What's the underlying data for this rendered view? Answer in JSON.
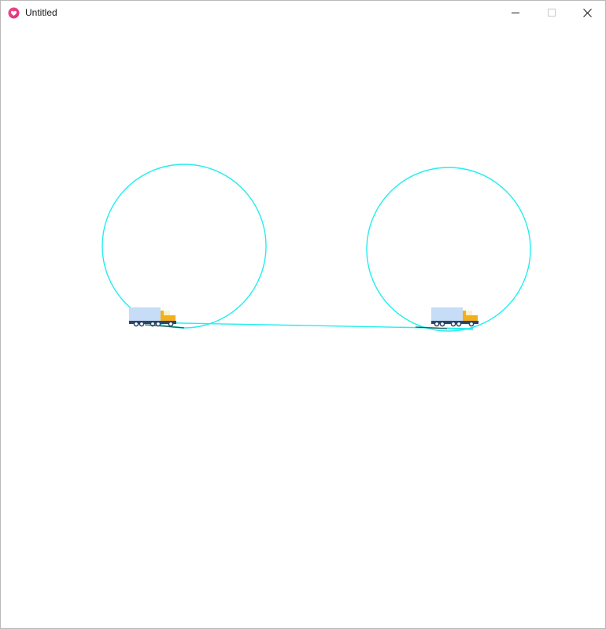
{
  "window": {
    "title": "Untitled",
    "app_icon": "heart-app-icon",
    "controls": [
      "minimize-icon",
      "maximize-icon",
      "close-icon"
    ]
  },
  "scene": {
    "circle_color": "#22eeee",
    "track_color": "#22eeee",
    "truck_icon": "truck-icon"
  }
}
